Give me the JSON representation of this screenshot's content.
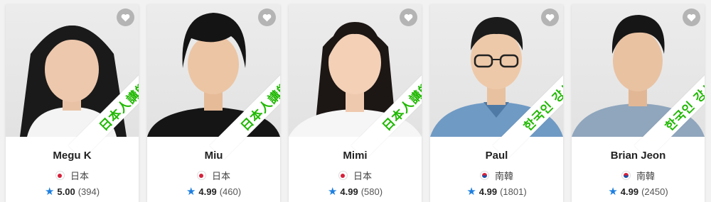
{
  "colors": {
    "ribbon_text": "#1fb800",
    "star": "#1d7fe0",
    "favorite_bg": "#aaaaaa"
  },
  "icons": {
    "favorite": "heart-icon",
    "rating": "star-icon"
  },
  "tutors": [
    {
      "name": "Megu K",
      "country": "日本",
      "flag": "japan-flag-icon",
      "badge": "日本人講師",
      "rating": "5.00",
      "reviews": "(394)"
    },
    {
      "name": "Miu",
      "country": "日本",
      "flag": "japan-flag-icon",
      "badge": "日本人講師",
      "rating": "4.99",
      "reviews": "(460)"
    },
    {
      "name": "Mimi",
      "country": "日本",
      "flag": "japan-flag-icon",
      "badge": "日本人講師",
      "rating": "4.99",
      "reviews": "(580)"
    },
    {
      "name": "Paul",
      "country": "南韓",
      "flag": "korea-flag-icon",
      "badge": "한국인 강사",
      "rating": "4.99",
      "reviews": "(1801)"
    },
    {
      "name": "Brian Jeon",
      "country": "南韓",
      "flag": "korea-flag-icon",
      "badge": "한국인 강사",
      "rating": "4.99",
      "reviews": "(2450)"
    }
  ]
}
